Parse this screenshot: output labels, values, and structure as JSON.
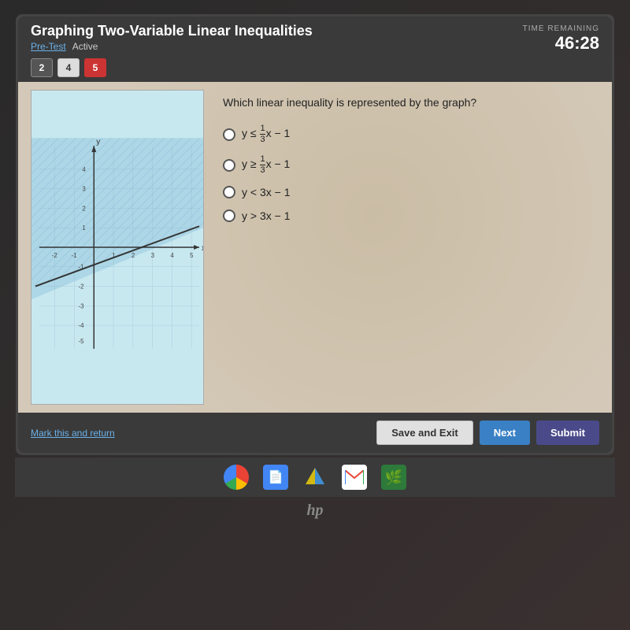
{
  "header": {
    "title": "Graphing Two-Variable Linear Inequalities",
    "pre_test": "Pre-Test",
    "status": "Active",
    "time_label": "TIME REMAINING",
    "time_value": "46:28"
  },
  "navigation": {
    "buttons": [
      {
        "label": "2",
        "style": "default"
      },
      {
        "label": "4",
        "style": "white"
      },
      {
        "label": "5",
        "style": "red"
      }
    ]
  },
  "question": {
    "text": "Which linear inequality is represented by the graph?",
    "options": [
      {
        "id": "a",
        "text_raw": "y ≤ (1/3)x − 1"
      },
      {
        "id": "b",
        "text_raw": "y ≥ (1/3)x − 1"
      },
      {
        "id": "c",
        "text_raw": "y < 3x − 1"
      },
      {
        "id": "d",
        "text_raw": "y > 3x − 1"
      }
    ]
  },
  "footer": {
    "mark_return": "Mark this and return",
    "save_exit": "Save and Exit",
    "next": "Next",
    "submit": "Submit"
  },
  "taskbar": {
    "icons": [
      "chrome",
      "files",
      "drive",
      "gmail",
      "leaf"
    ]
  },
  "colors": {
    "accent_blue": "#3a80c4",
    "accent_red": "#cc3333",
    "header_bg": "#3a3a3a",
    "quiz_bg": "#d4c9b8"
  }
}
